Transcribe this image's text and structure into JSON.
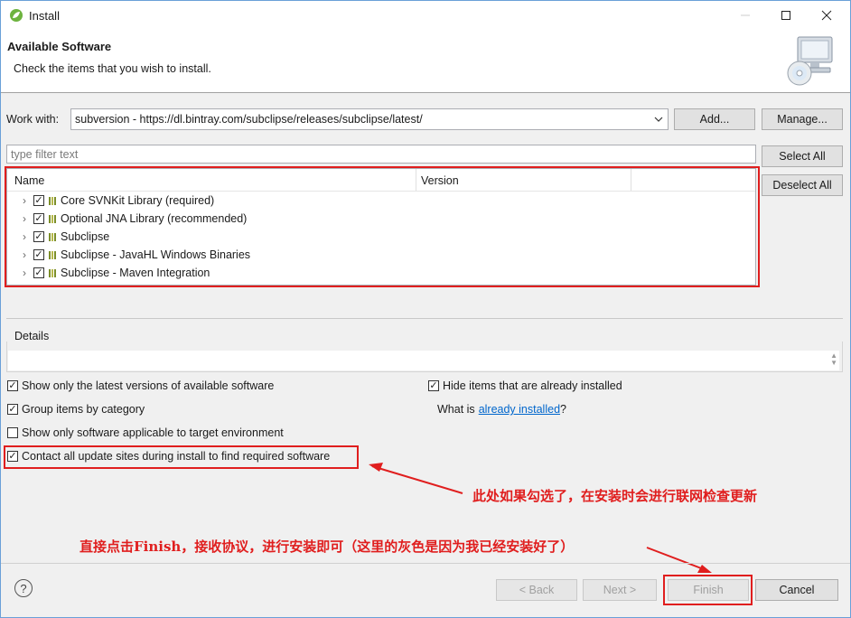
{
  "window": {
    "title": "Install"
  },
  "banner": {
    "title": "Available Software",
    "subtitle": "Check the items that you wish to install."
  },
  "work_with": {
    "label": "Work with:",
    "value": "subversion - https://dl.bintray.com/subclipse/releases/subclipse/latest/",
    "add_label": "Add...",
    "manage_label": "Manage..."
  },
  "filter": {
    "placeholder": "type filter text"
  },
  "buttons": {
    "select_all": "Select All",
    "deselect_all": "Deselect All"
  },
  "table": {
    "headers": [
      "Name",
      "Version"
    ],
    "items": [
      {
        "label": "Core SVNKit Library (required)",
        "checked": true
      },
      {
        "label": "Optional JNA Library (recommended)",
        "checked": true
      },
      {
        "label": "Subclipse",
        "checked": true
      },
      {
        "label": "Subclipse - JavaHL Windows Binaries",
        "checked": true
      },
      {
        "label": "Subclipse - Maven Integration",
        "checked": true
      }
    ]
  },
  "details": {
    "label": "Details"
  },
  "options": {
    "latest_only": "Show only the latest versions of available software",
    "group_by_category": "Group items by category",
    "target_env": "Show only software applicable to target environment",
    "contact_sites": "Contact all update sites during install to find required software",
    "hide_installed": "Hide items that are already installed",
    "what_is_prefix": "What is",
    "already_installed_link": "already installed",
    "what_is_suffix": "?"
  },
  "annotations": {
    "note1": "此处如果勾选了，在安装时会进行联网检查更新",
    "note2": "直接点击Finish，接收协议，进行安装即可（这里的灰色是因为我已经安装好了）"
  },
  "footer": {
    "help": "?",
    "back": "< Back",
    "next": "Next >",
    "finish": "Finish",
    "cancel": "Cancel"
  },
  "colors": {
    "annotation": "#e01e1e",
    "link": "#0066cc",
    "window_border": "#6aa0d8"
  }
}
